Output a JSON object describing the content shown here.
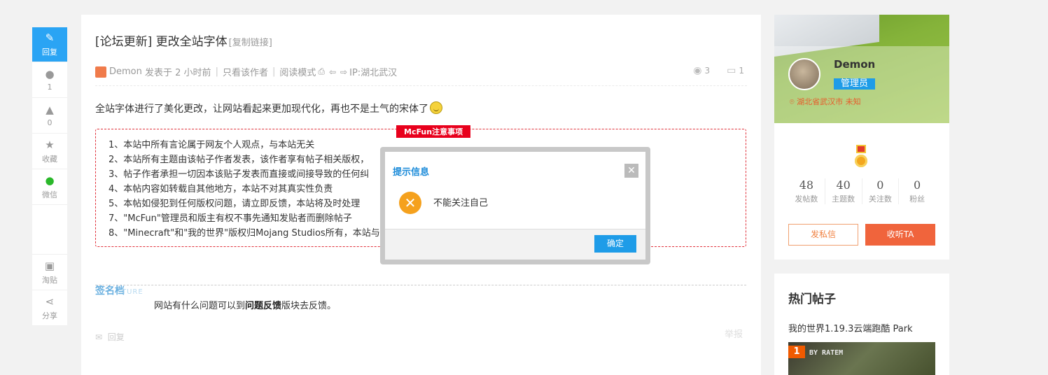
{
  "side_actions": {
    "reply": "回复",
    "comments_count": "1",
    "likes_count": "0",
    "favorite": "收藏",
    "wechat": "微信",
    "tao": "淘贴",
    "share": "分享"
  },
  "post": {
    "title": "[论坛更新] 更改全站字体",
    "copy_link": "[复制链接]",
    "author": "Demon",
    "posted": "发表于 2 小时前",
    "only_author": "只看该作者",
    "read_mode": "阅读模式",
    "ip": "IP:湖北武汉",
    "views": "3",
    "replies": "1",
    "body": "全站字体进行了美化更改，让网站看起来更加现代化，再也不是土气的宋体了"
  },
  "notice": {
    "tag": "McFun注意事项",
    "items": [
      "1、本站中所有言论属于网友个人观点，与本站无关",
      "2、本站所有主题由该帖子作者发表，该作者享有帖子相关版权，",
      "3、帖子作者承担一切因本该贴子发表而直接或间接导致的任何纠",
      "4、本帖内容如转载自其他地方，本站不对其真实性负责",
      "5、本帖如侵犯到任何版权问题，请立即反馈，本站将及时处理",
      "7、\"McFun\"管理员和版主有权不事先通知发贴者而删除帖子",
      "8、\"Minecraft\"和\"我的世界\"版权归Mojang Studios所有，本站与"
    ]
  },
  "signature": {
    "title": "签名档",
    "sub": "TURE",
    "text_before": "网站有什么问题可以到",
    "text_bold": "问题反馈",
    "text_after": "版块去反馈。"
  },
  "actions": {
    "reply": "回复",
    "report": "举报"
  },
  "profile": {
    "name": "Demon",
    "role": "管理员",
    "location": "湖北省武汉市 未知",
    "stats": [
      {
        "num": "48",
        "label": "发帖数"
      },
      {
        "num": "40",
        "label": "主题数"
      },
      {
        "num": "0",
        "label": "关注数"
      },
      {
        "num": "0",
        "label": "粉丝"
      }
    ],
    "pm_button": "发私信",
    "follow_button": "收听TA"
  },
  "hot": {
    "title": "热门帖子",
    "item": "我的世界1.19.3云端跑酷 Park",
    "rank": "1",
    "thumb_text": "BY RATEM"
  },
  "dialog": {
    "title": "提示信息",
    "message": "不能关注自己",
    "ok": "确定"
  },
  "colors": {
    "accent": "#1e9ce8",
    "follow": "#f0643c",
    "notice_border": "#e0303a"
  }
}
